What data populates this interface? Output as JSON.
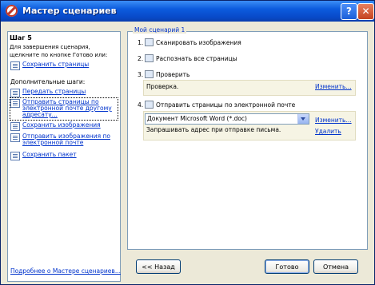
{
  "window": {
    "title": "Мастер сценариев",
    "help_button": "?",
    "close_button": "✕"
  },
  "sidebar": {
    "step_title": "Шаг 5",
    "step_description": "Для завершения сценария, щелкните по кнопке Готово или:",
    "save_pages_link": "Сохранить страницы",
    "extra_steps_label": "Дополнительные шаги:",
    "items": [
      {
        "label": "Передать страницы"
      },
      {
        "label": "Отправить страницы по",
        "label2": "электронной почте другому",
        "label3": "адресату..."
      },
      {
        "label": "Сохранить изображения"
      },
      {
        "label": "Отправить изображения по",
        "label2": "электронной почте"
      },
      {
        "label": "Сохранить пакет"
      }
    ],
    "more_link": "Подробнее о Мастере сценариев..."
  },
  "scenario": {
    "title": "Мой сценарий 1",
    "steps": [
      {
        "num": "1.",
        "label": "Сканировать изображения"
      },
      {
        "num": "2.",
        "label": "Распознать все страницы"
      },
      {
        "num": "3.",
        "label": "Проверить"
      },
      {
        "num": "4.",
        "label": "Отправить страницы по электронной почте"
      }
    ],
    "check_value": "Проверка.",
    "change_link": "Изменить...",
    "format_value": "Документ Microsoft Word (*.doc)",
    "ask_address_text": "Запрашивать адрес при отправке письма.",
    "delete_link": "Удалить"
  },
  "buttons": {
    "back": "<< Назад",
    "done": "Готово",
    "cancel": "Отмена"
  }
}
